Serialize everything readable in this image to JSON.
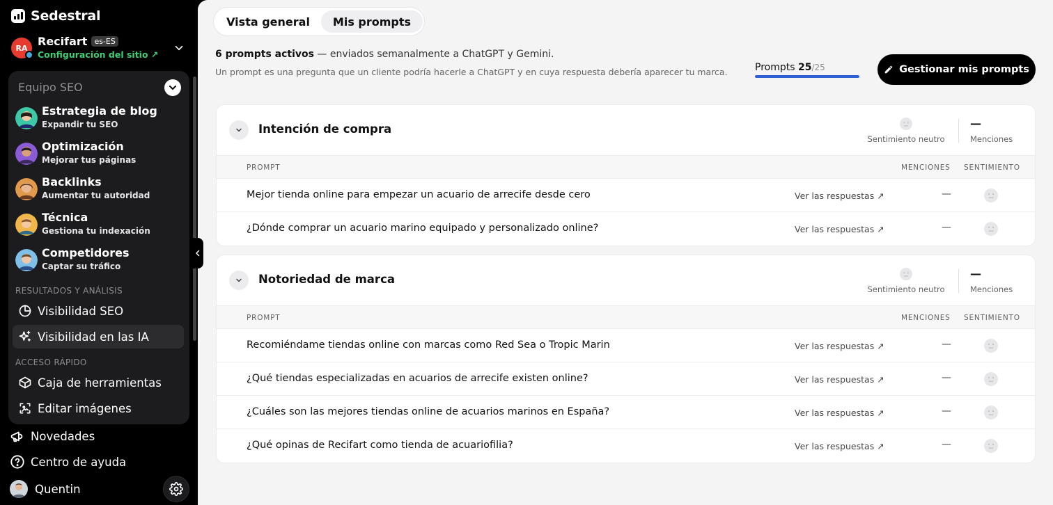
{
  "sidebar": {
    "brand": "Sedestral",
    "site": {
      "logo_text": "RA",
      "name": "Recifart",
      "locale": "es-ES",
      "config_label": "Configuración del sitio ↗"
    },
    "team": {
      "header": "Equipo SEO",
      "agents": [
        {
          "title": "Estrategia de blog",
          "subtitle": "Expandir tu SEO"
        },
        {
          "title": "Optimización",
          "subtitle": "Mejorar tus páginas"
        },
        {
          "title": "Backlinks",
          "subtitle": "Aumentar tu autoridad"
        },
        {
          "title": "Técnica",
          "subtitle": "Gestiona tu indexación"
        },
        {
          "title": "Competidores",
          "subtitle": "Captar su tráfico"
        }
      ],
      "results_label": "RESULTADOS Y ANÁLISIS",
      "results_items": [
        "Visibilidad SEO",
        "Visibilidad en las IA"
      ],
      "quick_label": "ACCESO RÁPIDO",
      "quick_items": [
        "Caja de herramientas",
        "Editar imágenes"
      ]
    },
    "bottom": {
      "news": "Novedades",
      "help": "Centro de ayuda",
      "user": "Quentin"
    }
  },
  "main": {
    "tabs": [
      "Vista general",
      "Mis prompts"
    ],
    "active_tab": "Mis prompts",
    "summary_bold": "6 prompts activos",
    "summary_rest": " — enviados semanalmente a ChatGPT y Gemini.",
    "description": "Un prompt es una pregunta que un cliente podría hacerle a ChatGPT y en cuya respuesta debería aparecer tu marca.",
    "counter": {
      "label": "Prompts",
      "used": "25",
      "total": "/25",
      "fraction": 1.0
    },
    "manage_button": "Gestionar mis prompts",
    "column_headers": {
      "prompt": "PROMPT",
      "mentions": "MENCIONES",
      "sentiment": "SENTIMIENTO"
    },
    "view_link": "Ver las respuestas ↗",
    "groups": [
      {
        "title": "Intención de compra",
        "sentiment": "Sentimiento neutro",
        "mentions_value": "—",
        "mentions_label": "Menciones",
        "prompts": [
          {
            "text": "Mejor tienda online para empezar un acuario de arrecife desde cero",
            "mentions": "—"
          },
          {
            "text": "¿Dónde comprar un acuario marino equipado y personalizado online?",
            "mentions": "—"
          }
        ]
      },
      {
        "title": "Notoriedad de marca",
        "sentiment": "Sentimiento neutro",
        "mentions_value": "—",
        "mentions_label": "Menciones",
        "prompts": [
          {
            "text": "Recomiéndame tiendas online con marcas como Red Sea o Tropic Marin",
            "mentions": "—"
          },
          {
            "text": "¿Qué tiendas especializadas en acuarios de arrecife existen online?",
            "mentions": "—"
          },
          {
            "text": "¿Cuáles son las mejores tiendas online de acuarios marinos en España?",
            "mentions": "—"
          },
          {
            "text": "¿Qué opinas de Recifart como tienda de acuariofilia?",
            "mentions": "—"
          }
        ]
      }
    ]
  },
  "colors": {
    "accent_green": "#3fcf73",
    "progress_blue": "#2f5fd7",
    "site_red": "#e63b2e"
  }
}
